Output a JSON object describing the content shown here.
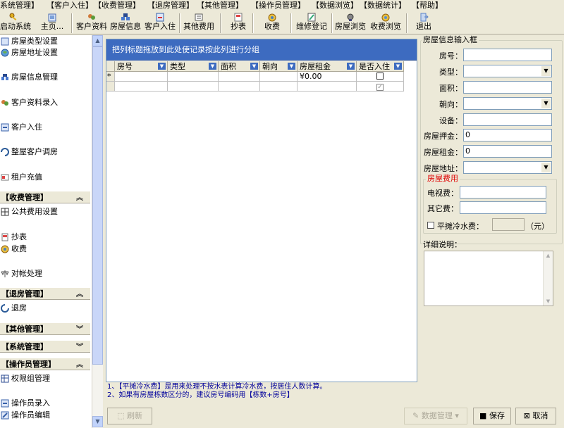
{
  "menu": [
    "系统管理】",
    "【客户入住】",
    "【收费管理】",
    "【退房管理】",
    "【其他管理】",
    "【操作员管理】",
    "【数据浏览】",
    "【数据统计】",
    "【帮助】"
  ],
  "toolbar": [
    {
      "label": "启动系统",
      "icon": "key-icon",
      "color": "#d9a820"
    },
    {
      "label": "主页...",
      "icon": "home-icon",
      "color": "#5a7fc6"
    },
    {
      "label": "客户资料",
      "icon": "client-data-icon",
      "color": "#c0703a"
    },
    {
      "label": "房屋信息",
      "icon": "house-info-icon",
      "color": "#2f6ab2"
    },
    {
      "label": "客户入住",
      "icon": "checkin-icon",
      "color": "#355fa8"
    },
    {
      "label": "其他费用",
      "icon": "other-fee-icon",
      "color": "#556"
    },
    {
      "label": "抄表",
      "icon": "meter-icon",
      "color": "#c33"
    },
    {
      "label": "收费",
      "icon": "charge-icon",
      "color": "#4a7fbf"
    },
    {
      "label": "维修登记",
      "icon": "repair-icon",
      "color": "#3a7"
    },
    {
      "label": "房屋浏览",
      "icon": "house-browse-icon",
      "color": "#447"
    },
    {
      "label": "收费浏览",
      "icon": "charge-browse-icon",
      "color": "#5a8fd0"
    },
    {
      "label": "退出",
      "icon": "exit-icon",
      "color": "#5a82c8"
    }
  ],
  "sidebar": {
    "items": [
      {
        "label": "房屋类型设置",
        "icon": "house-type-icon"
      },
      {
        "label": "房屋地址设置",
        "icon": "globe-icon"
      },
      {
        "label": "房屋信息管理",
        "icon": "house-info-icon"
      },
      {
        "label": "客户资料录入",
        "icon": "client-data-icon"
      },
      {
        "label": "客户入住",
        "icon": "checkin-icon"
      },
      {
        "label": "整屋客户调房",
        "icon": "transfer-icon"
      },
      {
        "label": "租户充值",
        "icon": "recharge-icon"
      },
      {
        "label": "公共费用设置",
        "icon": "public-fee-icon"
      },
      {
        "label": "抄表",
        "icon": "meter-icon"
      },
      {
        "label": "收费",
        "icon": "charge-icon"
      },
      {
        "label": "对帐处理",
        "icon": "reconcile-icon"
      },
      {
        "label": "退房",
        "icon": "checkout-icon"
      },
      {
        "label": "权限组管理",
        "icon": "permission-icon"
      },
      {
        "label": "操作员录入",
        "icon": "operator-add-icon"
      },
      {
        "label": "操作员编辑",
        "icon": "operator-edit-icon"
      }
    ],
    "headers": [
      "【收费管理】",
      "【退房管理】",
      "【其他管理】",
      "【系统管理】",
      "【操作员管理】"
    ]
  },
  "grid": {
    "group_hint": "把列标题拖放到此处使记录按此列进行分组",
    "columns": [
      "房号",
      "类型",
      "面积",
      "朝向",
      "房屋租金",
      "是否入住"
    ],
    "new_row_marker": "*",
    "rent_default": "¥0.00"
  },
  "form": {
    "title": "房屋信息输入框",
    "fields": [
      {
        "label": "房号：",
        "value": ""
      },
      {
        "label": "类型：",
        "value": ""
      },
      {
        "label": "面积：",
        "value": ""
      },
      {
        "label": "朝向：",
        "value": ""
      },
      {
        "label": "设备：",
        "value": ""
      },
      {
        "label": "房屋押金：",
        "value": "0"
      },
      {
        "label": "房屋租金：",
        "value": "0"
      },
      {
        "label": "房屋地址：",
        "value": ""
      }
    ],
    "fee_group": {
      "title": "房屋费用",
      "title_color": "#e00000",
      "tv_label": "电视费：",
      "other_label": "其它费：",
      "water_label": "平摊冷水费：",
      "unit": "（元）"
    },
    "detail_label": "详细说明："
  },
  "notes": [
    "1、【平摊冷水费】是用来处理不按水表计算冷水费，按居住人数计算。",
    "2、如果有房屋栋数区分的，建议房号编码用【栋数+房号】"
  ],
  "bottom": {
    "refresh": "刷新",
    "data_mgmt": "数据管理",
    "save": "保存",
    "cancel": "取消"
  }
}
